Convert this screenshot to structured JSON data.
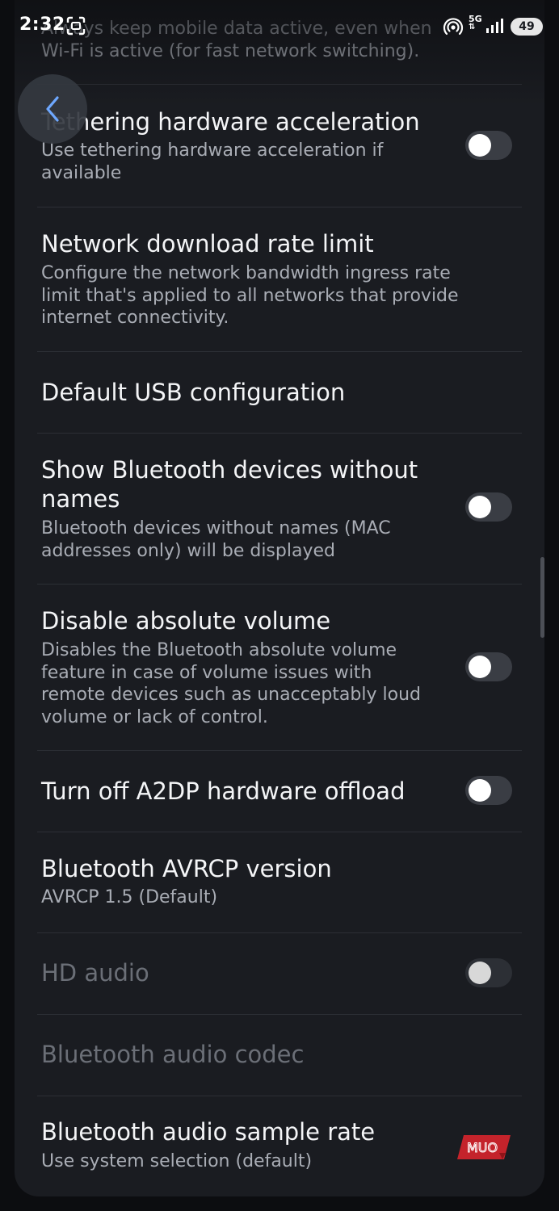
{
  "status_bar": {
    "time": "2:32",
    "network": "5G",
    "battery": "49"
  },
  "colors": {
    "background": "#0c0d10",
    "card": "#1a1c21",
    "title_text": "#f4f5f7",
    "summary_text": "#a9adb5",
    "disabled_text": "#6b6f77",
    "toggle_track_off": "#3a3d44",
    "toggle_knob": "#ffffff",
    "watermark_red": "#c4232b"
  },
  "clipped_item": {
    "summary_line_1": "Always keep mobile data active, even when",
    "summary_line_2": "Wi-Fi is active (for fast network switching)."
  },
  "settings": [
    {
      "title": "Tethering hardware acceleration",
      "summary": "Use tethering hardware acceleration if available",
      "toggle": "off"
    },
    {
      "title": "Network download rate limit",
      "summary": "Configure the network bandwidth ingress rate limit that's applied to all networks that provide internet connectivity."
    },
    {
      "title": "Default USB configuration"
    },
    {
      "title": "Show Bluetooth devices without names",
      "summary": "Bluetooth devices without names (MAC addresses only) will be displayed",
      "toggle": "off"
    },
    {
      "title": "Disable absolute volume",
      "summary": "Disables the Bluetooth absolute volume feature in case of volume issues with remote devices such as unacceptably loud volume or lack of control.",
      "toggle": "off"
    },
    {
      "title": "Turn off A2DP hardware offload",
      "toggle": "off"
    },
    {
      "title": "Bluetooth AVRCP version",
      "summary": "AVRCP 1.5 (Default)"
    },
    {
      "title": "HD audio",
      "toggle": "off",
      "disabled": true
    },
    {
      "title": "Bluetooth audio codec",
      "disabled": true
    },
    {
      "title": "Bluetooth audio sample rate",
      "summary": "Use system selection (default)"
    }
  ],
  "watermark": {
    "text": "MUO"
  },
  "icons": {
    "back": "chevron-left-icon",
    "screenshot": "screenshot-icon",
    "hotspot": "hotspot-icon",
    "signal": "signal-icon",
    "battery": "battery-icon"
  }
}
